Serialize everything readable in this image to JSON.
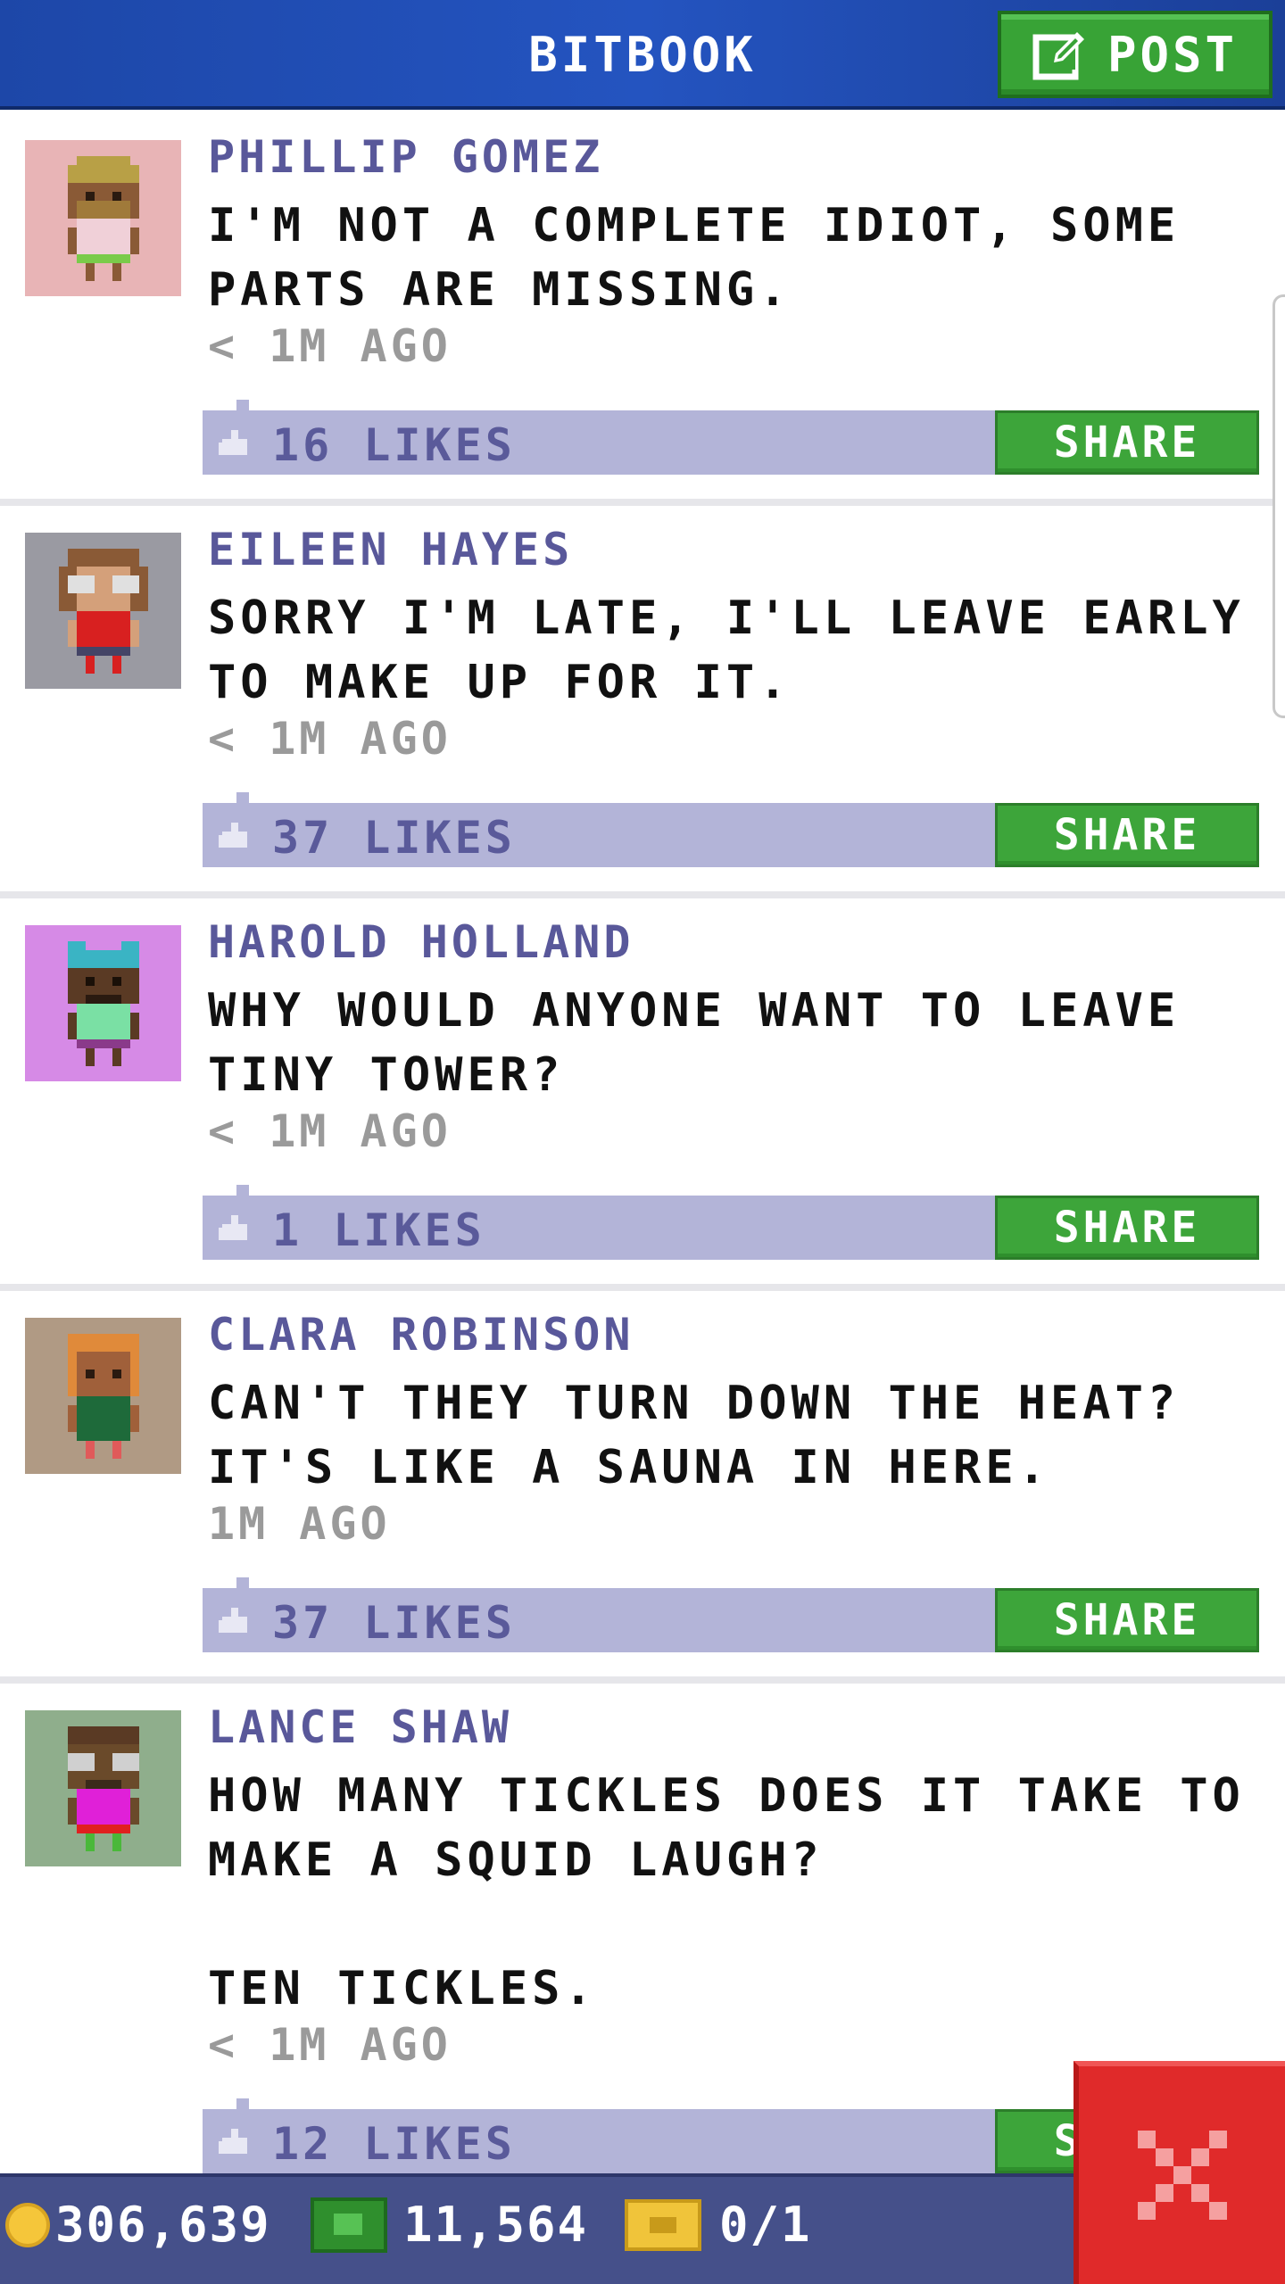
{
  "header": {
    "title": "BITBOOK",
    "post_label": "POST"
  },
  "posts": [
    {
      "author": "PHILLIP GOMEZ",
      "text": "I'M NOT A COMPLETE IDIOT, SOME PARTS ARE MISSING.",
      "time": "< 1M AGO",
      "likes": "16 LIKES",
      "share": "SHARE",
      "avatar_bg": "#e8b4b6"
    },
    {
      "author": "EILEEN HAYES",
      "text": "SORRY I'M LATE, I'LL LEAVE EARLY TO MAKE UP FOR IT.",
      "time": "< 1M AGO",
      "likes": "37 LIKES",
      "share": "SHARE",
      "avatar_bg": "#9a9aa2"
    },
    {
      "author": "HAROLD HOLLAND",
      "text": "WHY WOULD ANYONE WANT TO LEAVE TINY TOWER?",
      "time": "< 1M AGO",
      "likes": "1 LIKES",
      "share": "SHARE",
      "avatar_bg": "#d68ae6"
    },
    {
      "author": "CLARA ROBINSON",
      "text": "CAN'T THEY TURN DOWN THE HEAT? IT'S LIKE A SAUNA IN HERE.",
      "time": "1M AGO",
      "likes": "37 LIKES",
      "share": "SHARE",
      "avatar_bg": "#b09a84"
    },
    {
      "author": "LANCE SHAW",
      "text": "HOW MANY TICKLES DOES IT TAKE TO MAKE A SQUID LAUGH?\n\nTEN TICKLES.",
      "time": "< 1M AGO",
      "likes": "12 LIKES",
      "share": "SHARE",
      "avatar_bg": "#8fae8c"
    }
  ],
  "footer": {
    "coins": "306,639",
    "bux": "11,564",
    "tickets": "0/1"
  },
  "colors": {
    "header_blue": "#2454c0",
    "share_green": "#3da53a",
    "likes_bar": "#b3b4d8",
    "author_purple": "#59589a",
    "close_red": "#e02a2a"
  },
  "icons": {
    "post": "edit-icon",
    "likes": "thumbs-up-icon",
    "close": "close-icon",
    "coin": "coin-icon",
    "bux": "cash-icon",
    "ticket": "ticket-icon"
  }
}
